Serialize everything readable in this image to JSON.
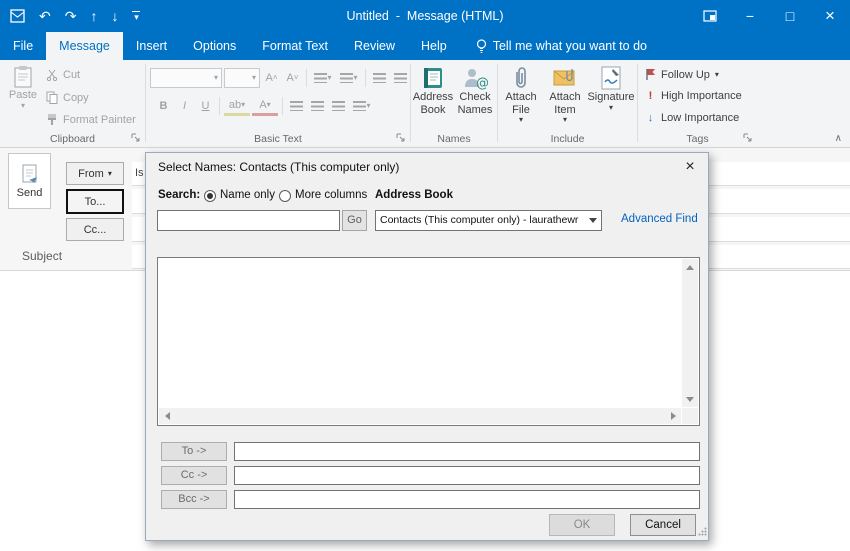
{
  "titlebar": {
    "title": "Untitled  -  Message (HTML)"
  },
  "tabs": {
    "items": [
      {
        "label": "File"
      },
      {
        "label": "Message"
      },
      {
        "label": "Insert"
      },
      {
        "label": "Options"
      },
      {
        "label": "Format Text"
      },
      {
        "label": "Review"
      },
      {
        "label": "Help"
      }
    ],
    "tell_me": "Tell me what you want to do"
  },
  "ribbon": {
    "clipboard": {
      "group_label": "Clipboard",
      "paste": "Paste",
      "cut": "Cut",
      "copy": "Copy",
      "format_painter": "Format Painter"
    },
    "basic_text": {
      "group_label": "Basic Text",
      "bold": "B",
      "italic": "I",
      "underline": "U",
      "highlight": "ab",
      "font_color": "A",
      "grow_font": "A",
      "shrink_font": "A"
    },
    "names": {
      "group_label": "Names",
      "address_book": "Address Book",
      "check_names": "Check Names"
    },
    "include": {
      "group_label": "Include",
      "attach_file": "Attach File",
      "attach_item": "Attach Item",
      "signature": "Signature"
    },
    "tags": {
      "group_label": "Tags",
      "follow_up": "Follow Up",
      "high_importance": "High Importance",
      "low_importance": "Low Importance"
    }
  },
  "compose": {
    "send": "Send",
    "from": "From",
    "to": "To...",
    "cc": "Cc...",
    "subject": "Subject",
    "from_fragment": "Is"
  },
  "dialog": {
    "title": "Select Names: Contacts (This computer only)",
    "search_label": "Search:",
    "name_only": "Name only",
    "more_columns": "More columns",
    "address_book_label": "Address Book",
    "search_value": "",
    "go": "Go",
    "address_book_value": "Contacts (This computer only) - laurathewr",
    "advanced_find": "Advanced Find",
    "to": "To ->",
    "cc": "Cc ->",
    "bcc": "Bcc ->",
    "to_value": "",
    "cc_value": "",
    "bcc_value": "",
    "ok": "OK",
    "cancel": "Cancel"
  },
  "icons": {
    "dropdown": "▾",
    "undo": "↶",
    "redo": "↷",
    "up": "↑",
    "down": "↓",
    "minimize": "−",
    "maximize": "□",
    "close": "×",
    "collapse_ribbon": "∧",
    "high_importance_mark": "!",
    "low_importance_arrow": "↓"
  },
  "colors": {
    "titlebar_blue": "#0072c6",
    "link_blue": "#0563c1",
    "flag_red": "#c0504d",
    "importance_red": "#c0392b",
    "importance_blue": "#2e77bc"
  }
}
